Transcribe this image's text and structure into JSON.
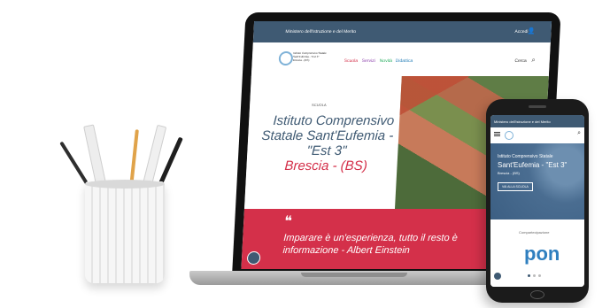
{
  "laptop": {
    "topbar_text": "Ministero dell'Istruzione e del Merito",
    "topbar_right": "Accedi",
    "school_small": "Istituto Comprensivo Statale Sant'Eufemia - \"Est 3\" Brescia - (BS)",
    "nav": [
      "Scuola",
      "Servizi",
      "Novità",
      "Didattica"
    ],
    "search_label": "Cerca",
    "hero_kicker": "SCUOLA",
    "hero_title_1": "Istituto Comprensivo",
    "hero_title_2": "Statale Sant'Eufemia -",
    "hero_title_3": "\"Est 3\"",
    "hero_city": "Brescia - (BS)",
    "quote_open": "❝",
    "quote_line_1": "Imparare è un'esperienza, tutto il resto è",
    "quote_line_2": "informazione - Albert Einstein",
    "quote_close": "❞"
  },
  "phone": {
    "topbar_text": "Ministero dell'Istruzione e del Merito",
    "title_small": "Istituto Comprensivo Statale",
    "title_big": "Sant'Eufemia - \"Est 3\"",
    "city": "Brescia - (BS)",
    "button": "VAI ALLA SCUOLA",
    "partner_label": "Compartecipazione",
    "pon": "pon"
  },
  "colors": {
    "primary": "#3f5a73",
    "accent": "#d4304a"
  }
}
